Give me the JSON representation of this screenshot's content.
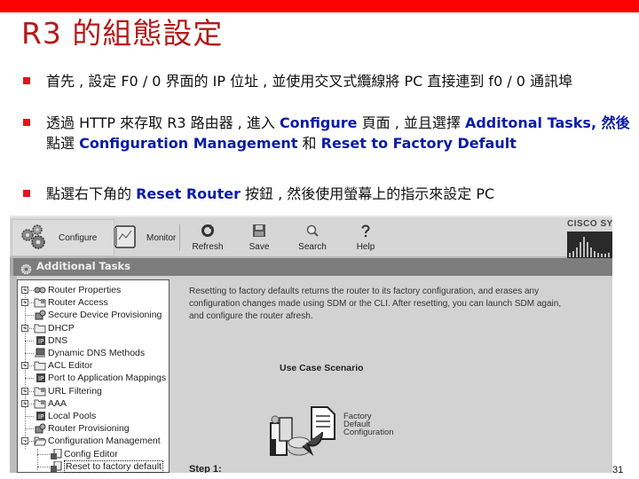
{
  "slide": {
    "title": "R3 的組態設定",
    "page_number": "31",
    "accent_color": "#ff0000",
    "title_color": "#b31b1b",
    "highlight_color": "#0a1ca8"
  },
  "bullets": [
    {
      "segments": [
        {
          "text": "首先 , 設定  F0 / 0 界面的  IP 位址 , 並使用交叉式纜線將    PC 直接連到  f0 / 0 通訊埠",
          "highlight": false
        }
      ]
    },
    {
      "segments": [
        {
          "text": "透過  HTTP 來存取  R3 路由器 , 進入  ",
          "highlight": false
        },
        {
          "text": "Configure",
          "highlight": true
        },
        {
          "text": " 頁面 , 並且選擇 ",
          "highlight": false
        },
        {
          "text": "Additonal Tasks,   然後",
          "highlight": true
        },
        {
          "text": " 點選  ",
          "highlight": false
        },
        {
          "text": "Configuration Management",
          "highlight": true
        },
        {
          "text": " 和 ",
          "highlight": false
        },
        {
          "text": "Reset to Factory Default",
          "highlight": true
        }
      ]
    },
    {
      "segments": [
        {
          "text": "點選右下角的   ",
          "highlight": false
        },
        {
          "text": "Reset Router",
          "highlight": true
        },
        {
          "text": " 按鈕 , 然後使用螢幕上的指示來設定     PC",
          "highlight": false
        }
      ]
    }
  ],
  "screenshot": {
    "toolbar": {
      "configure": {
        "label": "Configure",
        "icon": "gears-icon"
      },
      "monitor": {
        "label": "Monitor",
        "icon": "monitor-chart-icon"
      },
      "refresh": {
        "label": "Refresh",
        "icon": "refresh-icon"
      },
      "save": {
        "label": "Save",
        "icon": "floppy-disk-icon"
      },
      "search": {
        "label": "Search",
        "icon": "magnifier-icon"
      },
      "help": {
        "label": "Help",
        "icon": "question-mark-icon"
      },
      "brand": "CISCO SYS"
    },
    "panel_title": "Additional Tasks",
    "tree": [
      {
        "label": "Router Properties",
        "expandable": true,
        "icon": "router-properties-icon"
      },
      {
        "label": "Router Access",
        "expandable": true,
        "icon": "folder-lock-icon"
      },
      {
        "label": "Secure Device Provisioning",
        "expandable": false,
        "icon": "device-provisioning-icon"
      },
      {
        "label": "DHCP",
        "expandable": true,
        "icon": "folder-icon"
      },
      {
        "label": "DNS",
        "expandable": false,
        "icon": "ip-icon"
      },
      {
        "label": "Dynamic DNS Methods",
        "expandable": false,
        "icon": "dns-computer-icon"
      },
      {
        "label": "ACL Editor",
        "expandable": true,
        "icon": "folder-icon"
      },
      {
        "label": "Port to Application Mappings",
        "expandable": false,
        "icon": "ip-icon"
      },
      {
        "label": "URL Filtering",
        "expandable": true,
        "icon": "folder-lock-icon"
      },
      {
        "label": "AAA",
        "expandable": true,
        "icon": "folder-lock-icon"
      },
      {
        "label": "Local Pools",
        "expandable": false,
        "icon": "ip-icon"
      },
      {
        "label": "Router Provisioning",
        "expandable": false,
        "icon": "device-provisioning-icon"
      },
      {
        "label": "Configuration Management",
        "expandable": true,
        "expanded": true,
        "icon": "folder-open-icon"
      },
      {
        "label": "Config Editor",
        "child": true,
        "icon": "config-document-icon"
      },
      {
        "label": "Reset to factory default",
        "child": true,
        "selected": true,
        "icon": "config-document-icon"
      }
    ],
    "description": "Resetting to factory defaults returns the router to its factory configuration, and erases any configuration changes made using SDM or the CLI. After resetting, you can launch SDM again, and configure the router afresh.",
    "use_case_title": "Use Case Scenario",
    "factory_label": [
      "Factory",
      "Default",
      "Configuration"
    ],
    "step_label": "Step 1:"
  }
}
